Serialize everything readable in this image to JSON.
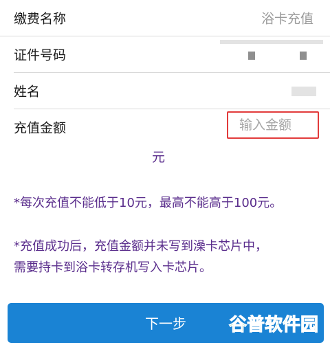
{
  "form": {
    "payment_name": {
      "label": "缴费名称",
      "value": "浴卡充值"
    },
    "id_number": {
      "label": "证件号码"
    },
    "name": {
      "label": "姓名"
    },
    "amount": {
      "label": "充值金额",
      "placeholder": "输入金额",
      "unit": "元"
    }
  },
  "notices": [
    "*每次充值不能低于10元，最高不能高于100元。",
    "*充值成功后，充值金额并未写到澡卡芯片中，",
    "需要持卡到浴卡转存机写入卡芯片。"
  ],
  "next_button": {
    "label": "下一步"
  },
  "watermark": {
    "text": "谷普软件园"
  },
  "colors": {
    "notice_purple": "#5a2d8c",
    "button_blue": "#1a83d4",
    "highlight_red": "#e23b3b",
    "watermark_green": "#1f9b3a"
  }
}
